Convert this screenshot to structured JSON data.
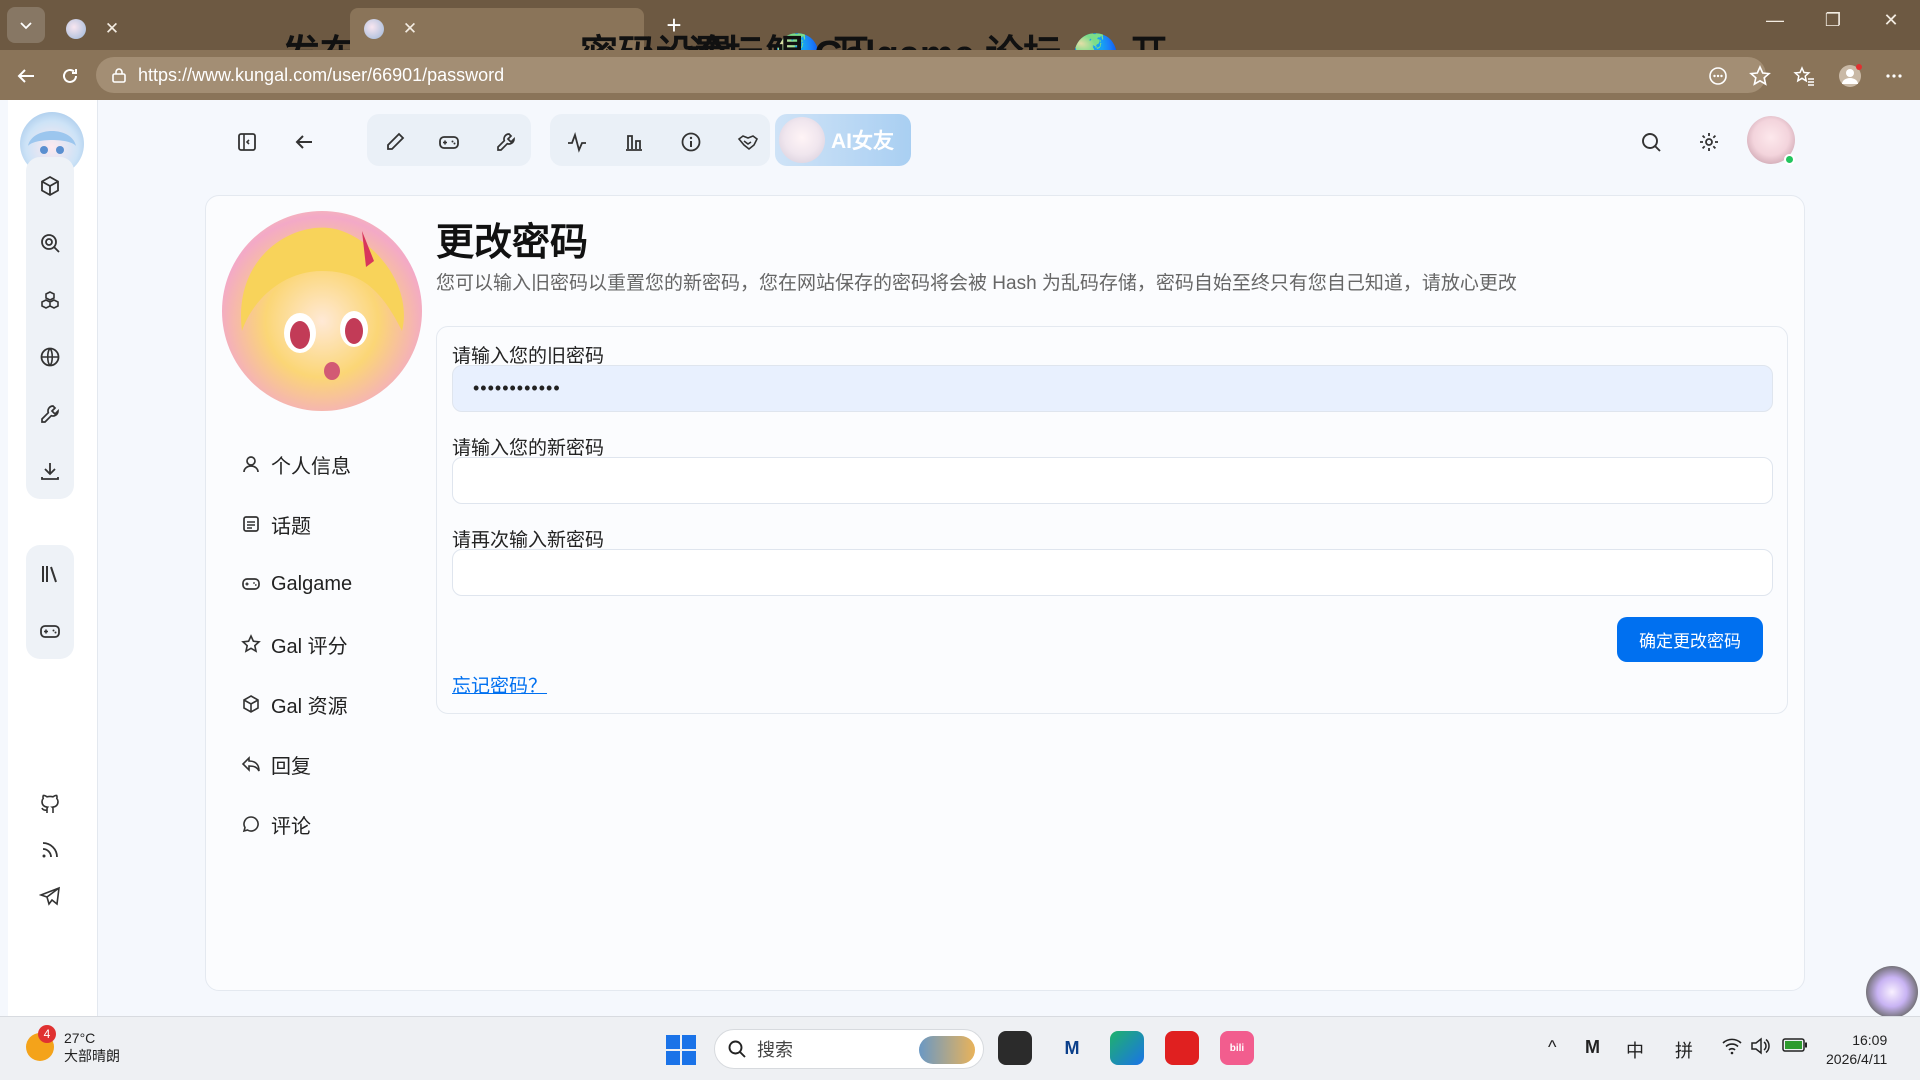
{
  "browser": {
    "tabs": [
      {
        "title": "发布话题 - 鲲 Galgame 论坛 🌏 开",
        "active": false
      },
      {
        "title": "密码设置 - 鲲 Galgame 论坛 🌏 开",
        "active": true
      }
    ],
    "url": "https://www.kungal.com/user/66901/password"
  },
  "site": {
    "ai_label": "AI女友"
  },
  "profile_menu": [
    {
      "label": "个人信息",
      "icon": "user-icon"
    },
    {
      "label": "话题",
      "icon": "topic-icon"
    },
    {
      "label": "Galgame",
      "icon": "gamepad-icon"
    },
    {
      "label": "Gal 评分",
      "icon": "star-icon"
    },
    {
      "label": "Gal 资源",
      "icon": "package-icon"
    },
    {
      "label": "回复",
      "icon": "reply-icon"
    },
    {
      "label": "评论",
      "icon": "comment-icon"
    }
  ],
  "password_form": {
    "title": "更改密码",
    "description": "您可以输入旧密码以重置您的新密码，您在网站保存的密码将会被 Hash 为乱码存储，密码自始至终只有您自己知道，请放心更改",
    "old_label": "请输入您的旧密码",
    "old_value": "••••••••••••",
    "new_label": "请输入您的新密码",
    "new_value": "",
    "repeat_label": "请再次输入新密码",
    "repeat_value": "",
    "submit_label": "确定更改密码",
    "forgot_label": "忘记密码？"
  },
  "taskbar": {
    "weather_badge": "4",
    "temperature": "27°C",
    "weather_text": "大部晴朗",
    "search_label": "搜索",
    "ime_mode": "中",
    "ime_layout": "拼",
    "time": "16:09",
    "date": "2026/4/11"
  },
  "colors": {
    "accent": "#0070f0",
    "tab_bar": "#6d5942",
    "address_bar": "#8a7459"
  }
}
